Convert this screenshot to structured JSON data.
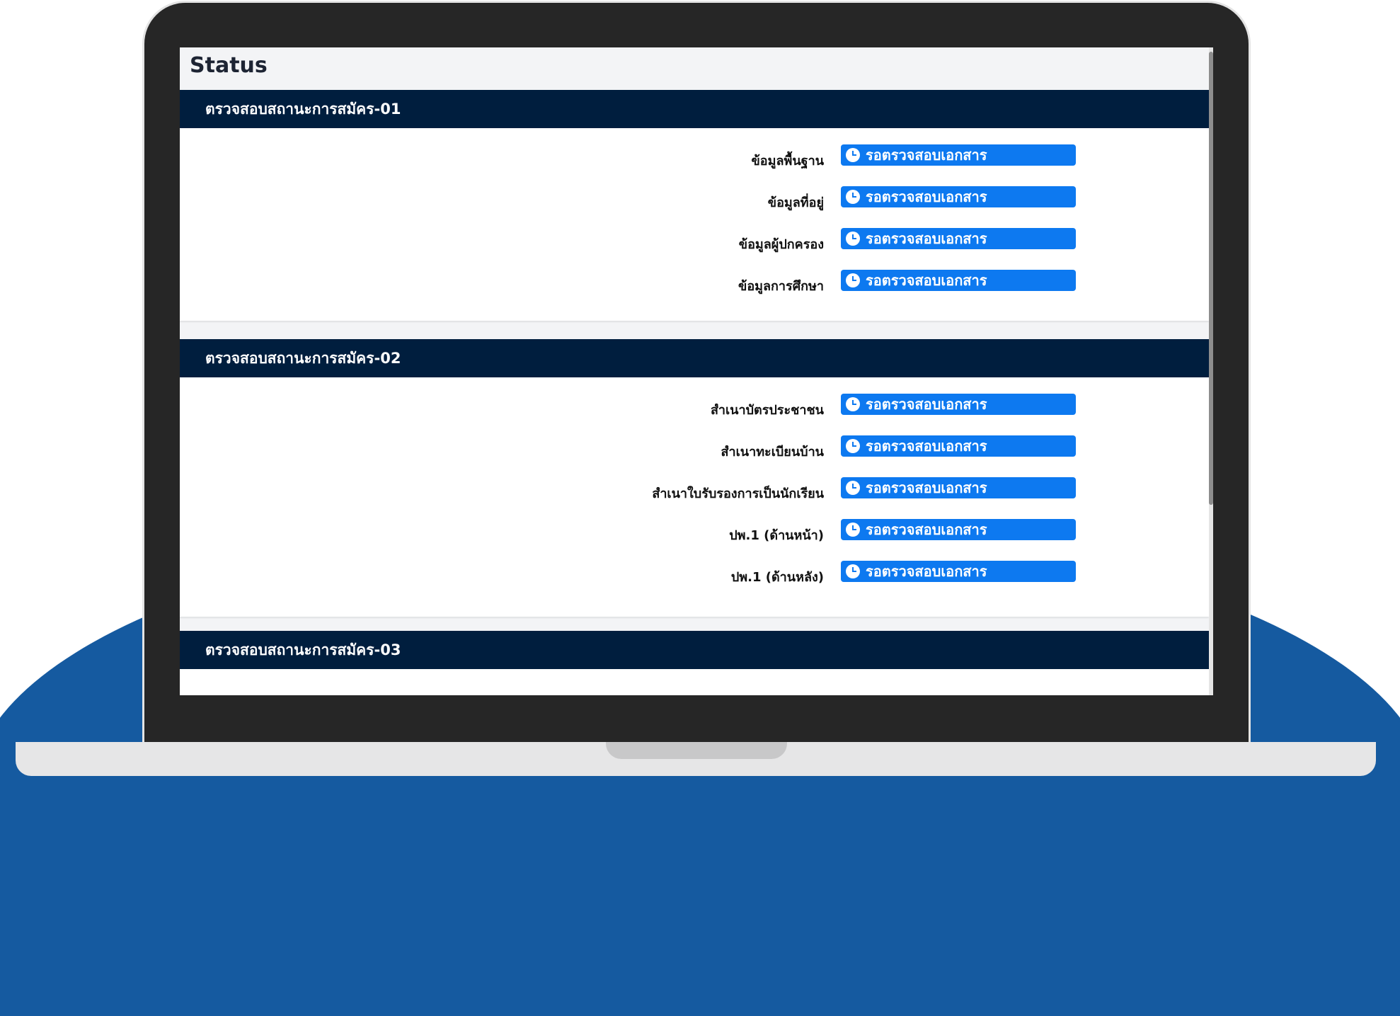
{
  "page": {
    "title": "Status"
  },
  "colors": {
    "section_header_bg": "#001e3e",
    "badge_bg": "#0d79f0",
    "background_accent": "#155aa0"
  },
  "sections": [
    {
      "title": "ตรวจสอบสถานะการสมัคร-01",
      "items": [
        {
          "label": "ข้อมูลพื้นฐาน",
          "status": "รอตรวจสอบเอกสาร",
          "icon": "clock-icon"
        },
        {
          "label": "ข้อมูลที่อยู่",
          "status": "รอตรวจสอบเอกสาร",
          "icon": "clock-icon"
        },
        {
          "label": "ข้อมูลผู้ปกครอง",
          "status": "รอตรวจสอบเอกสาร",
          "icon": "clock-icon"
        },
        {
          "label": "ข้อมูลการศึกษา",
          "status": "รอตรวจสอบเอกสาร",
          "icon": "clock-icon"
        }
      ]
    },
    {
      "title": "ตรวจสอบสถานะการสมัคร-02",
      "items": [
        {
          "label": "สำเนาบัตรประชาชน",
          "status": "รอตรวจสอบเอกสาร",
          "icon": "clock-icon"
        },
        {
          "label": "สำเนาทะเบียนบ้าน",
          "status": "รอตรวจสอบเอกสาร",
          "icon": "clock-icon"
        },
        {
          "label": "สำเนาใบรับรองการเป็นนักเรียน",
          "status": "รอตรวจสอบเอกสาร",
          "icon": "clock-icon"
        },
        {
          "label": "ปพ.1 (ด้านหน้า)",
          "status": "รอตรวจสอบเอกสาร",
          "icon": "clock-icon"
        },
        {
          "label": "ปพ.1 (ด้านหลัง)",
          "status": "รอตรวจสอบเอกสาร",
          "icon": "clock-icon"
        }
      ]
    },
    {
      "title": "ตรวจสอบสถานะการสมัคร-03",
      "items": []
    }
  ]
}
